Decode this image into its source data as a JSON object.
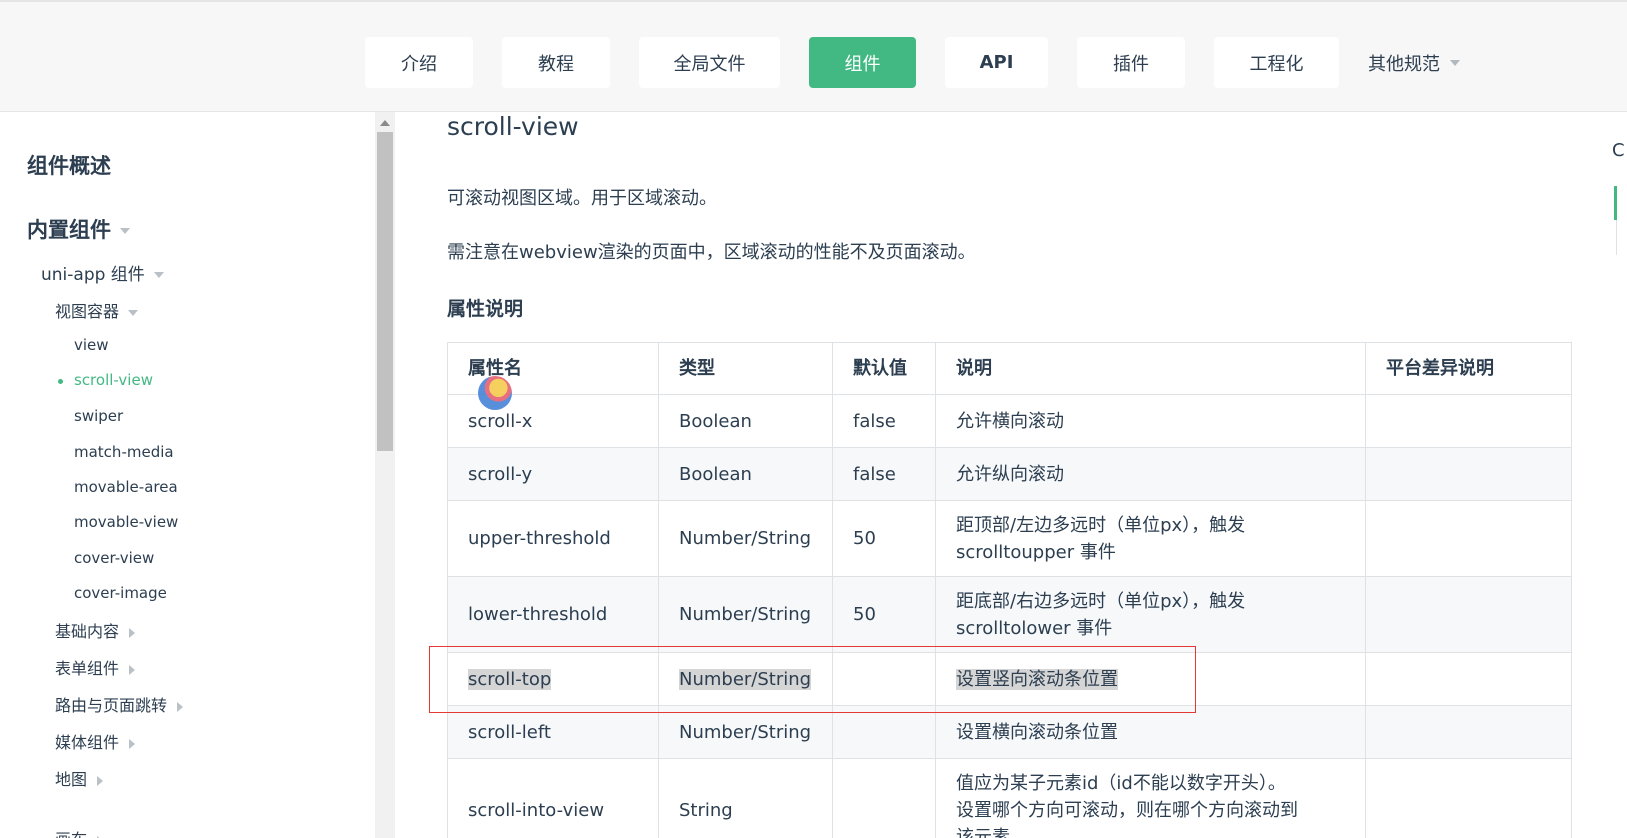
{
  "nav": {
    "items": [
      {
        "label": "介绍"
      },
      {
        "label": "教程"
      },
      {
        "label": "全局文件"
      },
      {
        "label": "组件"
      },
      {
        "label": "API"
      },
      {
        "label": "插件"
      },
      {
        "label": "工程化"
      },
      {
        "label": "其他规范"
      }
    ],
    "active": "组件",
    "accent_color": "#42b983"
  },
  "sidebar": {
    "heading_overview": "组件概述",
    "heading_builtin": "内置组件",
    "group_uniapp": "uni-app 组件",
    "group_view_container": "视图容器",
    "view_items": [
      "view",
      "scroll-view",
      "swiper",
      "match-media",
      "movable-area",
      "movable-view",
      "cover-view",
      "cover-image"
    ],
    "active_item": "scroll-view",
    "categories": [
      "基础内容",
      "表单组件",
      "路由与页面跳转",
      "媒体组件",
      "地图",
      "画布"
    ]
  },
  "content": {
    "title": "scroll-view",
    "desc1": "可滚动视图区域。用于区域滚动。",
    "desc2": "需注意在webview渲染的页面中，区域滚动的性能不及页面滚动。",
    "section_title": "属性说明",
    "table": {
      "headers": [
        "属性名",
        "类型",
        "默认值",
        "说明",
        "平台差异说明"
      ],
      "rows": [
        {
          "name": "scroll-x",
          "type": "Boolean",
          "default": "false",
          "desc": "允许横向滚动",
          "platform": ""
        },
        {
          "name": "scroll-y",
          "type": "Boolean",
          "default": "false",
          "desc": "允许纵向滚动",
          "platform": ""
        },
        {
          "name": "upper-threshold",
          "type": "Number/String",
          "default": "50",
          "desc_line1": "距顶部/左边多远时（单位px），触发",
          "desc_line2": "scrolltoupper 事件",
          "platform": ""
        },
        {
          "name": "lower-threshold",
          "type": "Number/String",
          "default": "50",
          "desc_line1": "距底部/右边多远时（单位px），触发",
          "desc_line2": "scrolltolower 事件",
          "platform": ""
        },
        {
          "name": "scroll-top",
          "type": "Number/String",
          "default": "",
          "desc": "设置竖向滚动条位置",
          "platform": ""
        },
        {
          "name": "scroll-left",
          "type": "Number/String",
          "default": "",
          "desc": "设置横向滚动条位置",
          "platform": ""
        },
        {
          "name": "scroll-into-view",
          "type": "String",
          "default": "",
          "desc_line1": "值应为某子元素id（id不能以数字开头）。",
          "desc_line2": "设置哪个方向可滚动，则在哪个方向滚动到",
          "desc_line3": "该元素",
          "platform": ""
        }
      ]
    }
  },
  "right_edge": {
    "fragment": "C"
  }
}
